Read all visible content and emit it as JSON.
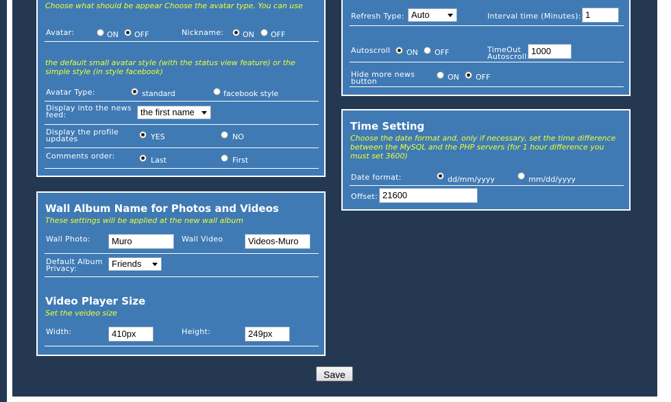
{
  "avatar_panel": {
    "intro": "Choose what should be appear Choose the avatar type. You can use",
    "avatar_label": "Avatar:",
    "avatar_options": [
      "ON",
      "OFF"
    ],
    "nickname_label": "Nickname:",
    "nickname_options": [
      "ON",
      "OFF"
    ],
    "style_note": "the default small avatar style (with the status view feature) or the simple style (in style facebook)",
    "avatar_type_label": "Avatar Type:",
    "avatar_type_options": [
      "standard",
      "facebook style"
    ],
    "news_feed_label": "Display into the news feed:",
    "news_feed_value": "the first name",
    "profile_updates_label": "Display the profile updates",
    "profile_updates_options": [
      "YES",
      "NO"
    ],
    "comments_order_label": "Comments order:",
    "comments_order_options": [
      "Last",
      "First"
    ]
  },
  "wall_panel": {
    "title": "Wall Album Name for Photos and Videos",
    "subtitle": "These settings will be applied at the new wall album",
    "wall_photo_label": "Wall Photo:",
    "wall_photo_value": "Muro",
    "wall_video_label": "Wall Video",
    "wall_video_value": "Videos-Muro",
    "privacy_label": "Default Album Privacy:",
    "privacy_value": "Friends",
    "player_title": "Video Player Size",
    "player_subtitle": "Set the veideo size",
    "width_label": "Width:",
    "width_value": "410px",
    "height_label": "Height:",
    "height_value": "249px"
  },
  "refresh_panel": {
    "refresh_type_label": "Refresh Type:",
    "refresh_type_value": "Auto",
    "interval_label": "Interval time (Minutes):",
    "interval_value": "1",
    "autoscroll_label": "Autoscroll",
    "autoscroll_options": [
      "ON",
      "OFF"
    ],
    "timeout_label": "TimeOut Autoscroll:",
    "timeout_value": "1000",
    "hide_news_label": "Hide more news button",
    "hide_news_options": [
      "ON",
      "OFF"
    ]
  },
  "time_panel": {
    "title": "Time Setting",
    "subtitle": "Choose the date format and, only if necessary, set the time difference between the MySQL and the PHP servers (for 1 hour difference you must set 3600)",
    "date_format_label": "Date format:",
    "date_format_options": [
      "dd/mm/yyyy",
      "mm/dd/yyyy"
    ],
    "offset_label": "Offset:",
    "offset_value": "21600"
  },
  "save_label": "Save",
  "colors": {
    "page_bg": "#243852",
    "panel_bg": "#3f7ab4",
    "note_text": "#eeff33",
    "border": "#ffffff"
  }
}
